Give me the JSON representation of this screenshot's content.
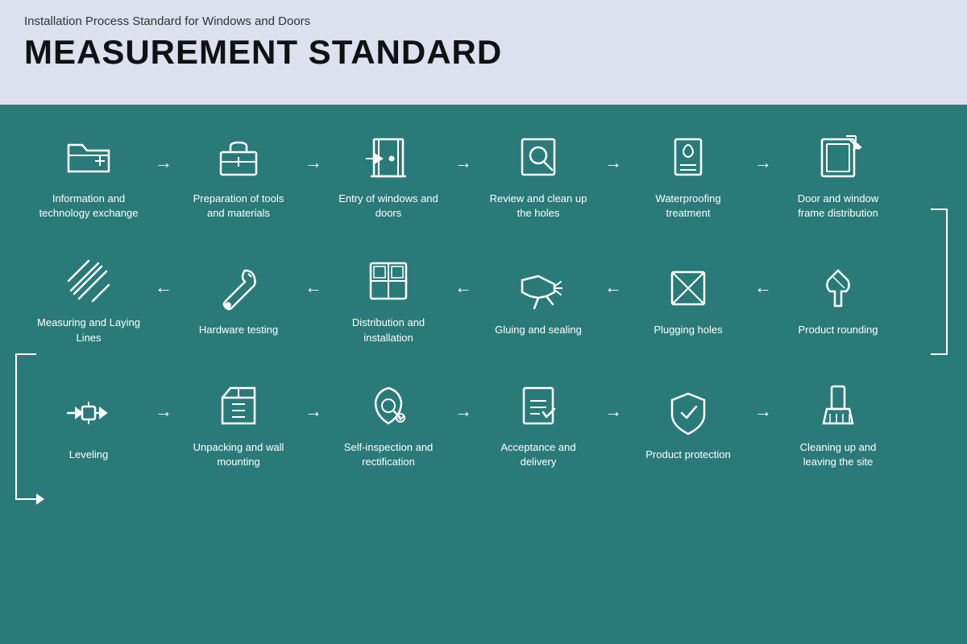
{
  "header": {
    "subtitle": "Installation Process Standard for Windows and Doors",
    "title": "MEASUREMENT STANDARD"
  },
  "row1": [
    {
      "id": "info-exchange",
      "label": "Information and technology exchange",
      "icon": "folder"
    },
    {
      "id": "tools-prep",
      "label": "Preparation of tools and materials",
      "icon": "toolbox"
    },
    {
      "id": "entry-windows",
      "label": "Entry of windows and doors",
      "icon": "door-enter"
    },
    {
      "id": "review-holes",
      "label": "Review and clean up the holes",
      "icon": "search"
    },
    {
      "id": "waterproofing",
      "label": "Waterproofing treatment",
      "icon": "water"
    },
    {
      "id": "frame-dist",
      "label": "Door and window frame distribution",
      "icon": "frame-export"
    }
  ],
  "row2": [
    {
      "id": "measuring",
      "label": "Measuring and Laying Lines",
      "icon": "ruler-cross"
    },
    {
      "id": "hardware",
      "label": "Hardware testing",
      "icon": "wrench"
    },
    {
      "id": "distribution",
      "label": "Distribution and installation",
      "icon": "grid-window"
    },
    {
      "id": "gluing",
      "label": "Gluing and sealing",
      "icon": "glue-gun"
    },
    {
      "id": "plugging",
      "label": "Plugging holes",
      "icon": "square-diagonal"
    },
    {
      "id": "rounding",
      "label": "Product rounding",
      "icon": "pin"
    }
  ],
  "row3": [
    {
      "id": "leveling",
      "label": "Leveling",
      "icon": "level"
    },
    {
      "id": "unpacking",
      "label": "Unpacking and wall mounting",
      "icon": "unpack"
    },
    {
      "id": "self-inspect",
      "label": "Self-inspection and rectification",
      "icon": "inspect"
    },
    {
      "id": "acceptance",
      "label": "Acceptance and delivery",
      "icon": "accept"
    },
    {
      "id": "product-protect",
      "label": "Product protection",
      "icon": "shield"
    },
    {
      "id": "cleaning",
      "label": "Cleaning up and leaving the site",
      "icon": "broom"
    }
  ]
}
